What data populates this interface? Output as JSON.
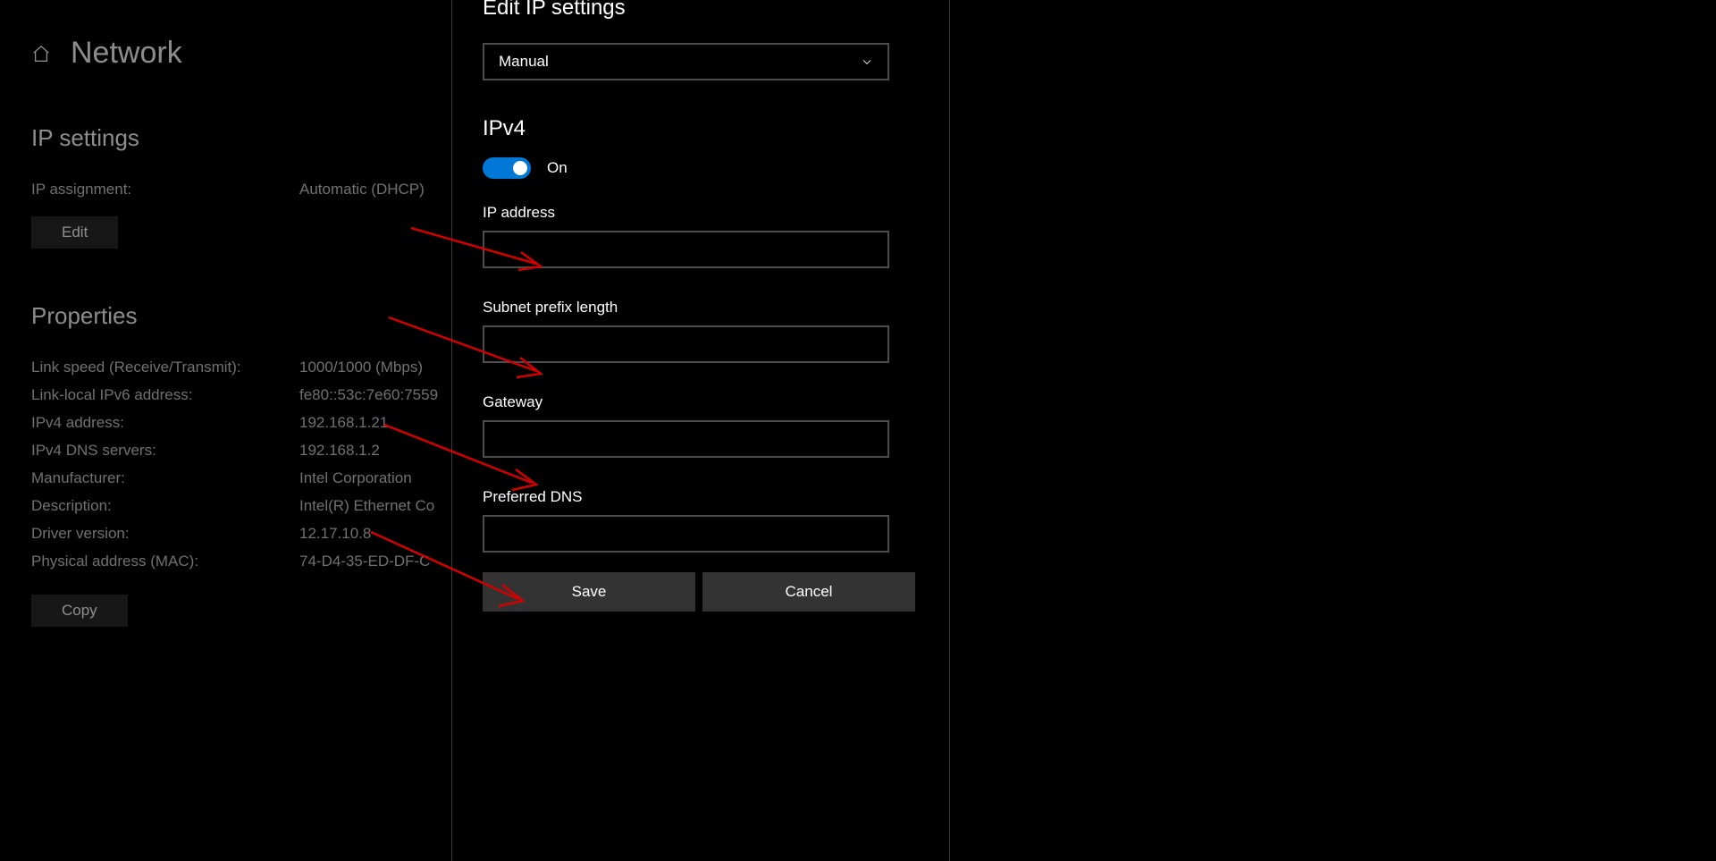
{
  "header": {
    "title": "Network"
  },
  "ip_settings": {
    "heading": "IP settings",
    "assignment_label": "IP assignment:",
    "assignment_value": "Automatic (DHCP)",
    "edit_button": "Edit"
  },
  "properties": {
    "heading": "Properties",
    "rows": [
      {
        "label": "Link speed (Receive/Transmit):",
        "value": "1000/1000 (Mbps)"
      },
      {
        "label": "Link-local IPv6 address:",
        "value": "fe80::53c:7e60:7559"
      },
      {
        "label": "IPv4 address:",
        "value": "192.168.1.21"
      },
      {
        "label": "IPv4 DNS servers:",
        "value": "192.168.1.2"
      },
      {
        "label": "Manufacturer:",
        "value": "Intel Corporation"
      },
      {
        "label": "Description:",
        "value": "Intel(R) Ethernet Co"
      },
      {
        "label": "Driver version:",
        "value": "12.17.10.8"
      },
      {
        "label": "Physical address (MAC):",
        "value": "74-D4-35-ED-DF-C"
      }
    ],
    "copy_button": "Copy"
  },
  "modal": {
    "title": "Edit IP settings",
    "mode_value": "Manual",
    "ipv4_heading": "IPv4",
    "toggle_state": "On",
    "fields": {
      "ip_address": {
        "label": "IP address",
        "value": ""
      },
      "subnet": {
        "label": "Subnet prefix length",
        "value": ""
      },
      "gateway": {
        "label": "Gateway",
        "value": ""
      },
      "dns": {
        "label": "Preferred DNS",
        "value": ""
      }
    },
    "save_button": "Save",
    "cancel_button": "Cancel"
  }
}
